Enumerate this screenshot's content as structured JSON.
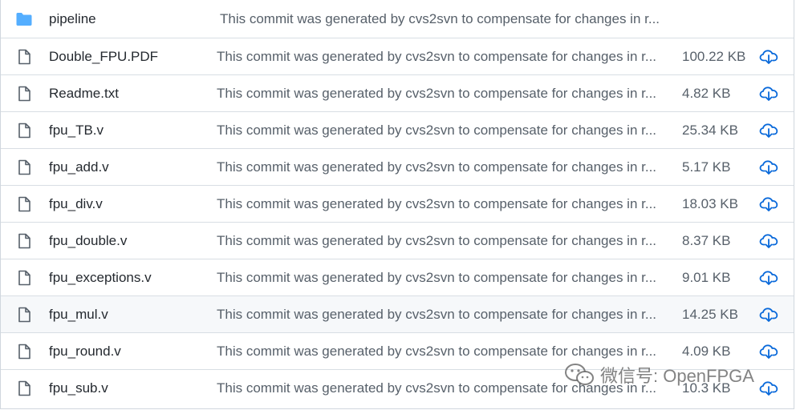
{
  "files": [
    {
      "type": "folder",
      "name": "pipeline",
      "message": "This commit was generated by cvs2svn to compensate for changes in r...",
      "size": "",
      "icon": "folder-icon"
    },
    {
      "type": "file",
      "name": "Double_FPU.PDF",
      "message": "This commit was generated by cvs2svn to compensate for changes in r...",
      "size": "100.22 KB",
      "icon": "file-icon"
    },
    {
      "type": "file",
      "name": "Readme.txt",
      "message": "This commit was generated by cvs2svn to compensate for changes in r...",
      "size": "4.82 KB",
      "icon": "file-icon"
    },
    {
      "type": "file",
      "name": "fpu_TB.v",
      "message": "This commit was generated by cvs2svn to compensate for changes in r...",
      "size": "25.34 KB",
      "icon": "file-icon"
    },
    {
      "type": "file",
      "name": "fpu_add.v",
      "message": "This commit was generated by cvs2svn to compensate for changes in r...",
      "size": "5.17 KB",
      "icon": "file-icon"
    },
    {
      "type": "file",
      "name": "fpu_div.v",
      "message": "This commit was generated by cvs2svn to compensate for changes in r...",
      "size": "18.03 KB",
      "icon": "file-icon"
    },
    {
      "type": "file",
      "name": "fpu_double.v",
      "message": "This commit was generated by cvs2svn to compensate for changes in r...",
      "size": "8.37 KB",
      "icon": "file-icon"
    },
    {
      "type": "file",
      "name": "fpu_exceptions.v",
      "message": "This commit was generated by cvs2svn to compensate for changes in r...",
      "size": "9.01 KB",
      "icon": "file-icon"
    },
    {
      "type": "file",
      "name": "fpu_mul.v",
      "message": "This commit was generated by cvs2svn to compensate for changes in r...",
      "size": "14.25 KB",
      "icon": "file-icon",
      "hovered": true
    },
    {
      "type": "file",
      "name": "fpu_round.v",
      "message": "This commit was generated by cvs2svn to compensate for changes in r...",
      "size": "4.09 KB",
      "icon": "file-icon"
    },
    {
      "type": "file",
      "name": "fpu_sub.v",
      "message": "This commit was generated by cvs2svn to compensate for changes in r...",
      "size": "10.3 KB",
      "icon": "file-icon"
    }
  ],
  "download_icon": "cloud-download-icon",
  "watermark": {
    "text": "微信号: OpenFPGA",
    "icon": "wechat-icon"
  },
  "colors": {
    "folder": "#54aeff",
    "download": "#0969da",
    "row_border": "#d8dee4",
    "hover_bg": "#f6f8fa"
  }
}
